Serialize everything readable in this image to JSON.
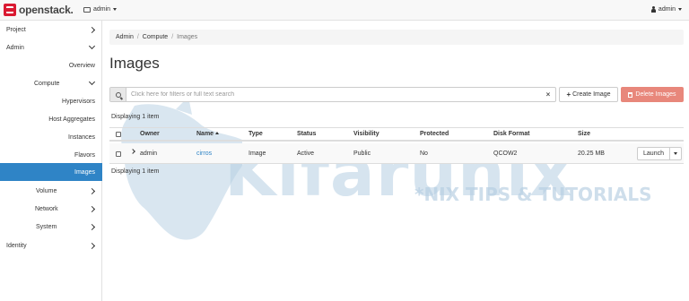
{
  "navbar": {
    "brand": "openstack.",
    "project": "admin",
    "user": "admin"
  },
  "sidebar": {
    "items": [
      {
        "label": "Project",
        "chevron": "right"
      },
      {
        "label": "Admin",
        "chevron": "down"
      },
      {
        "label": "Overview"
      },
      {
        "label": "Compute",
        "chevron": "down"
      },
      {
        "label": "Hypervisors"
      },
      {
        "label": "Host Aggregates"
      },
      {
        "label": "Instances"
      },
      {
        "label": "Flavors"
      },
      {
        "label": "Images",
        "active": true
      },
      {
        "label": "Volume",
        "chevron": "right"
      },
      {
        "label": "Network",
        "chevron": "right"
      },
      {
        "label": "System",
        "chevron": "right"
      },
      {
        "label": "Identity",
        "chevron": "right"
      }
    ]
  },
  "breadcrumb": {
    "items": [
      "Admin",
      "Compute",
      "Images"
    ],
    "separator": "/"
  },
  "page": {
    "title": "Images"
  },
  "filter": {
    "placeholder": "Click here for filters or full text search",
    "clear": "×"
  },
  "actions": {
    "create": "Create Image",
    "delete": "Delete Images"
  },
  "table": {
    "count_top": "Displaying 1 item",
    "count_bottom": "Displaying 1 item",
    "columns": [
      "Owner",
      "Name",
      "Type",
      "Status",
      "Visibility",
      "Protected",
      "Disk Format",
      "Size"
    ],
    "sorted_column": "Name",
    "rows": [
      {
        "owner": "admin",
        "name": "cirros",
        "type": "Image",
        "status": "Active",
        "visibility": "Public",
        "protected": "No",
        "disk_format": "QCOW2",
        "size": "20.25 MB",
        "action": "Launch"
      }
    ]
  },
  "watermark": {
    "brand": "Kifarunix",
    "tagline": "*NIX TIPS & TUTORIALS"
  },
  "colors": {
    "primary": "#2f84c6",
    "danger": "#e8877b",
    "brand_red": "#da1a32"
  }
}
